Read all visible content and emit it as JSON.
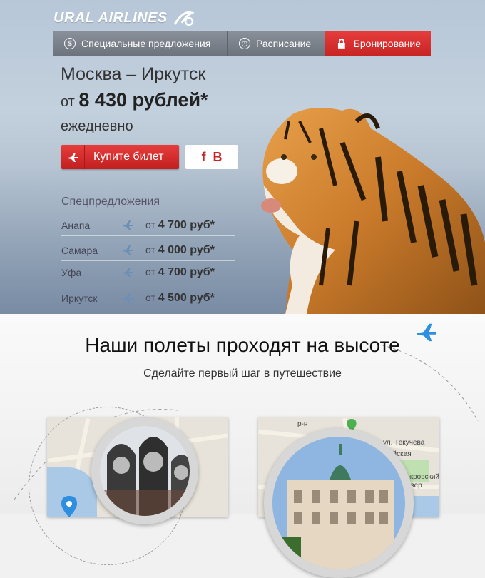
{
  "brand": {
    "name": "URAL AIRLINES"
  },
  "nav": {
    "items": [
      {
        "label": "Специальные предложения",
        "icon": "dollar-icon"
      },
      {
        "label": "Расписание",
        "icon": "clock-icon"
      },
      {
        "label": "Бронирование",
        "icon": "lock-icon",
        "active": true
      }
    ]
  },
  "hero": {
    "route": "Москва – Иркутск",
    "price_prefix": "от",
    "price": "8 430 рублей*",
    "frequency": "ежедневно",
    "buy_label": "Купите билет",
    "social": [
      "f",
      "B"
    ]
  },
  "offers": {
    "title": "Спецпредложения",
    "items": [
      {
        "city": "Анапа",
        "prefix": "от",
        "price": "4 700 руб*"
      },
      {
        "city": "Самара",
        "prefix": "от",
        "price": "4 000 руб*"
      },
      {
        "city": "Уфа",
        "prefix": "от",
        "price": "4 700 руб*"
      },
      {
        "city": "Иркутск",
        "prefix": "от",
        "price": "4 500 руб*"
      }
    ]
  },
  "section2": {
    "title": "Наши полеты проходят на высоте",
    "subtitle": "Сделайте первый шаг в путешествие"
  },
  "map_labels": {
    "right": [
      "р-н",
      "ул. Текучева",
      "армейская",
      "Покровский",
      "сквер"
    ]
  },
  "colors": {
    "accent": "#d32f2f",
    "nav": "#767c85"
  }
}
